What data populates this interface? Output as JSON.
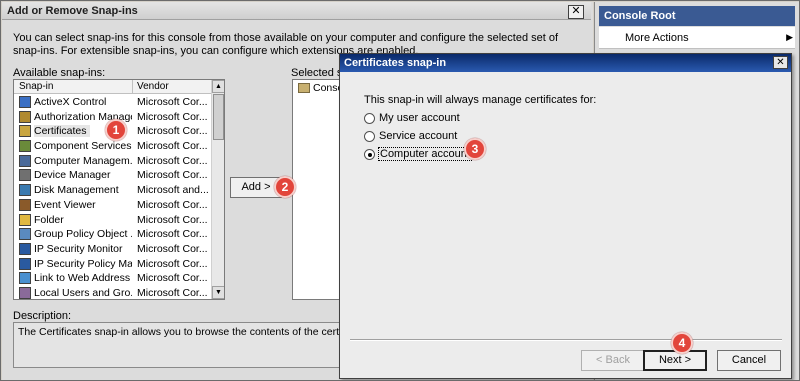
{
  "add_remove_dialog": {
    "title": "Add or Remove Snap-ins",
    "close_glyph": "✕",
    "intro": "You can select snap-ins for this console from those available on your computer and configure the selected set of snap-ins. For extensible snap-ins, you can configure which extensions are enabled.",
    "available_label": "Available snap-ins:",
    "columns": [
      "Snap-in",
      "Vendor"
    ],
    "snapins": [
      {
        "name": "ActiveX Control",
        "vendor": "Microsoft Cor...",
        "icon": "activex-icon"
      },
      {
        "name": "Authorization Manager",
        "vendor": "Microsoft Cor...",
        "icon": "authorization-icon"
      },
      {
        "name": "Certificates",
        "vendor": "Microsoft Cor...",
        "icon": "certificates-icon"
      },
      {
        "name": "Component Services",
        "vendor": "Microsoft Cor...",
        "icon": "component-services-icon"
      },
      {
        "name": "Computer Managem...",
        "vendor": "Microsoft Cor...",
        "icon": "computer-management-icon"
      },
      {
        "name": "Device Manager",
        "vendor": "Microsoft Cor...",
        "icon": "device-manager-icon"
      },
      {
        "name": "Disk Management",
        "vendor": "Microsoft and...",
        "icon": "disk-management-icon"
      },
      {
        "name": "Event Viewer",
        "vendor": "Microsoft Cor...",
        "icon": "event-viewer-icon"
      },
      {
        "name": "Folder",
        "vendor": "Microsoft Cor...",
        "icon": "folder-icon"
      },
      {
        "name": "Group Policy Object ...",
        "vendor": "Microsoft Cor...",
        "icon": "group-policy-icon"
      },
      {
        "name": "IP Security Monitor",
        "vendor": "Microsoft Cor...",
        "icon": "ip-security-monitor-icon"
      },
      {
        "name": "IP Security Policy Ma...",
        "vendor": "Microsoft Cor...",
        "icon": "ip-security-policy-icon"
      },
      {
        "name": "Link to Web Address",
        "vendor": "Microsoft Cor...",
        "icon": "link-icon"
      },
      {
        "name": "Local Users and Gro...",
        "vendor": "Microsoft Cor...",
        "icon": "local-users-icon"
      }
    ],
    "add_button": "Add >",
    "selected_label": "Selected sn",
    "selected_items": [
      "Conso"
    ],
    "description_label": "Description:",
    "description_text": "The Certificates snap-in allows you to browse the contents of the certificate s"
  },
  "console_panel": {
    "header": "Console Root",
    "item": "More Actions",
    "item_arrow": "▶"
  },
  "cert_dialog": {
    "title": "Certificates snap-in",
    "close_glyph": "✕",
    "prompt": "This snap-in will always manage certificates for:",
    "options": [
      {
        "label": "My user account",
        "selected": false
      },
      {
        "label": "Service account",
        "selected": false
      },
      {
        "label": "Computer account",
        "selected": true
      }
    ],
    "back_button": "< Back",
    "next_button": "Next >",
    "cancel_button": "Cancel"
  },
  "badges": [
    "1",
    "2",
    "3",
    "4"
  ],
  "colors": {
    "badge": "#e2453b",
    "console_header": "#3a5a93",
    "cert_title_bar": "#0a2a6a"
  }
}
